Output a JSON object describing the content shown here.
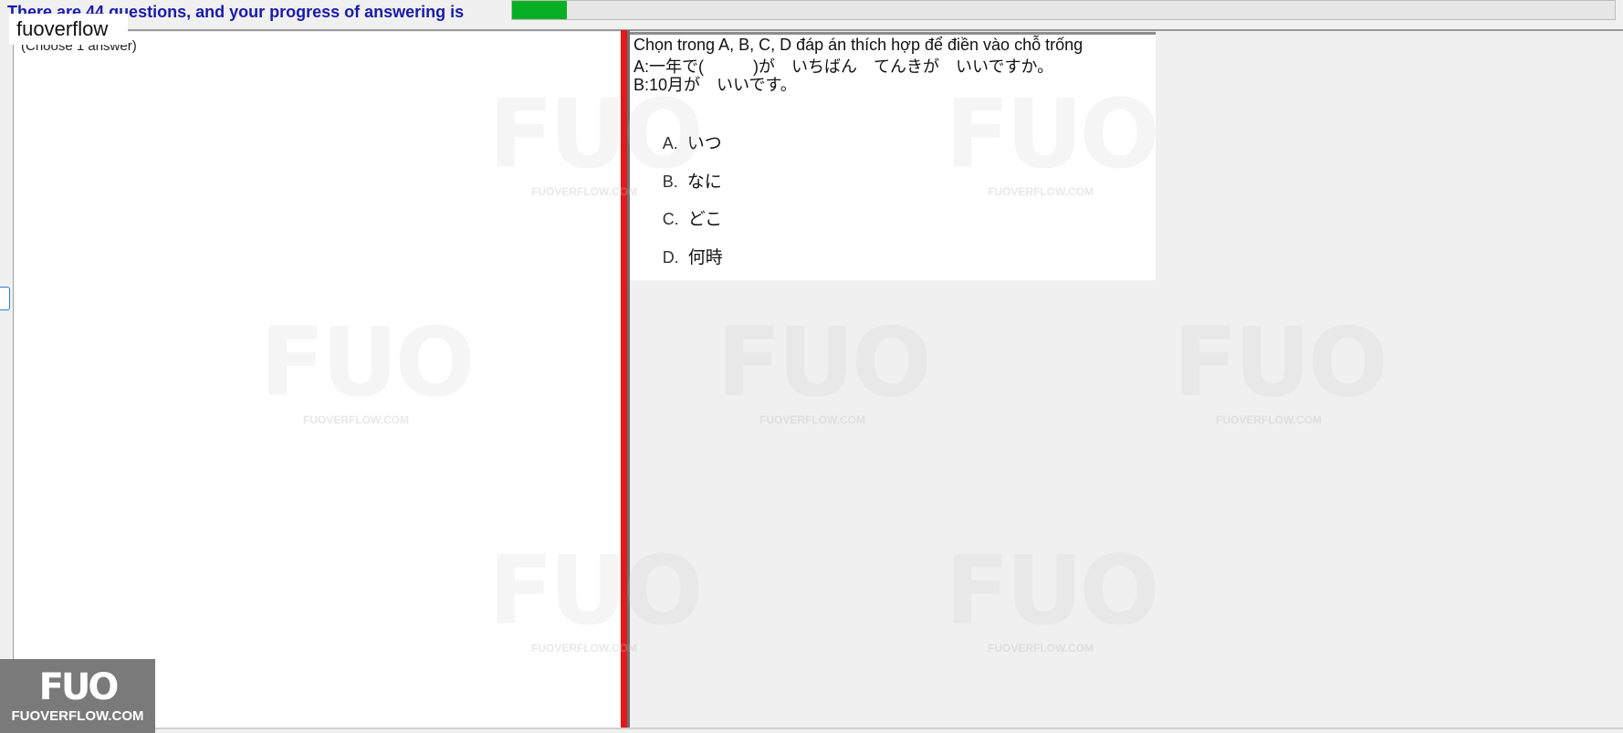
{
  "header": {
    "progress_text": "There are 44 questions, and your progress of answering is",
    "progress_value": 0.05,
    "progress_color": "#06b025"
  },
  "brand_label": "fuoverflow",
  "answer_panel": {
    "choose_text": "(Choose 1 answer)"
  },
  "question": {
    "instruction": "Chọn trong A, B, C, D đáp án thích hợp để điền vào chỗ trống",
    "line_a": "A:一年で(　　　)が　いちばん　てんきが　いいですか。",
    "line_b": "B:10月が　いいです。",
    "options": [
      {
        "letter": "A.",
        "text": "いつ"
      },
      {
        "letter": "B.",
        "text": "なに"
      },
      {
        "letter": "C.",
        "text": "どこ"
      },
      {
        "letter": "D.",
        "text": "何時"
      }
    ]
  },
  "watermark": {
    "big": "FUO",
    "small": "FUOVERFLOW.COM"
  },
  "logo": {
    "mark": "FUO",
    "site": "FUOVERFLOW.COM"
  },
  "colors": {
    "splitter": "#e3191b",
    "progress_text": "#1a1aa8"
  }
}
